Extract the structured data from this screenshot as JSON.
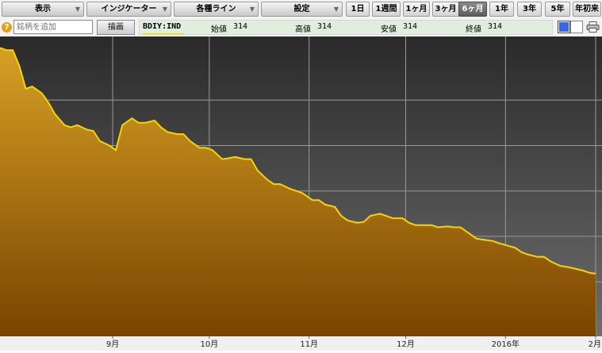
{
  "toolbar": {
    "display": "表示",
    "indicator": "インジケーター",
    "lines": "各種ライン",
    "settings": "設定",
    "periods": [
      "1日",
      "1週間",
      "1ヶ月",
      "3ヶ月",
      "6ヶ月",
      "1年",
      "3年",
      "5年",
      "年初来"
    ],
    "active_period": "6ヶ月"
  },
  "row2": {
    "help": "?",
    "symbol_placeholder": "銘柄を追加",
    "draw": "描画",
    "ticker": "BDIY:IND",
    "open_label": "始値",
    "open_value": "314",
    "high_label": "高値",
    "high_value": "314",
    "low_label": "安値",
    "low_value": "314",
    "close_label": "終値",
    "close_value": "314"
  },
  "colors": {
    "line": "#f5d400",
    "fill_top": "#d6a024",
    "fill_bottom": "#7a4300",
    "bg_top": "#2a2a2a",
    "bg_bottom": "#6d6d6d",
    "grid": "#9a9a9a"
  },
  "chart_data": {
    "type": "area",
    "series": [
      {
        "x": [
          "2015-07-28",
          "2015-07-30",
          "2015-08-01",
          "2015-08-03",
          "2015-08-05",
          "2015-08-07",
          "2015-08-10",
          "2015-08-12",
          "2015-08-14",
          "2015-08-17",
          "2015-08-19",
          "2015-08-21",
          "2015-08-24",
          "2015-08-26",
          "2015-08-28",
          "2015-08-31",
          "2015-09-02",
          "2015-09-04",
          "2015-09-07",
          "2015-09-09",
          "2015-09-11",
          "2015-09-14",
          "2015-09-16",
          "2015-09-18",
          "2015-09-21",
          "2015-09-23",
          "2015-09-25",
          "2015-09-28",
          "2015-09-30",
          "2015-10-02",
          "2015-10-05",
          "2015-10-07",
          "2015-10-09",
          "2015-10-12",
          "2015-10-14",
          "2015-10-16",
          "2015-10-19",
          "2015-10-21",
          "2015-10-23",
          "2015-10-26",
          "2015-10-28",
          "2015-10-30",
          "2015-11-02",
          "2015-11-04",
          "2015-11-06",
          "2015-11-09",
          "2015-11-11",
          "2015-11-13",
          "2015-11-16",
          "2015-11-18",
          "2015-11-20",
          "2015-11-23",
          "2015-11-25",
          "2015-11-27",
          "2015-11-30",
          "2015-12-02",
          "2015-12-04",
          "2015-12-07",
          "2015-12-09",
          "2015-12-11",
          "2015-12-14",
          "2015-12-16",
          "2015-12-18",
          "2015-12-21",
          "2015-12-23",
          "2015-12-28",
          "2015-12-30",
          "2016-01-04",
          "2016-01-06",
          "2016-01-08",
          "2016-01-11",
          "2016-01-13",
          "2016-01-15",
          "2016-01-18",
          "2016-01-20",
          "2016-01-22",
          "2016-01-25",
          "2016-01-27",
          "2016-01-29"
        ],
        "y": [
          1015,
          1010,
          1010,
          975,
          925,
          930,
          915,
          895,
          870,
          845,
          840,
          845,
          835,
          832,
          810,
          800,
          790,
          845,
          860,
          850,
          850,
          855,
          840,
          830,
          825,
          825,
          810,
          795,
          795,
          790,
          770,
          772,
          775,
          770,
          770,
          745,
          725,
          715,
          715,
          705,
          700,
          695,
          680,
          680,
          670,
          665,
          645,
          635,
          630,
          632,
          645,
          650,
          645,
          640,
          640,
          630,
          625,
          625,
          625,
          620,
          622,
          620,
          620,
          605,
          595,
          590,
          585,
          575,
          565,
          560,
          555,
          555,
          545,
          535,
          533,
          530,
          525,
          520,
          518
        ]
      }
    ],
    "x_tick_labels": [
      "9月",
      "10月",
      "11月",
      "12月",
      "2016年",
      "2月"
    ],
    "ylim": [
      380,
      1040
    ],
    "grid": true,
    "legend": "none"
  }
}
